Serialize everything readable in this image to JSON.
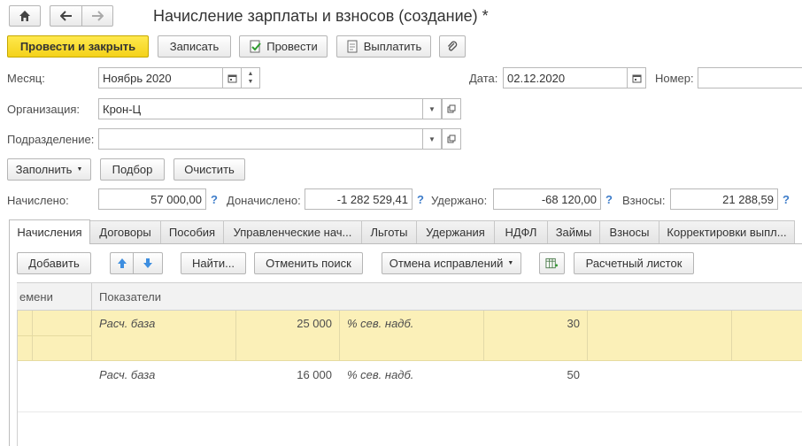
{
  "window": {
    "title": "Начисление зарплаты и взносов (создание) *"
  },
  "toolbar": {
    "post_close": "Провести и закрыть",
    "save": "Записать",
    "post": "Провести",
    "pay": "Выплатить"
  },
  "form": {
    "month_label": "Месяц:",
    "month_value": "Ноябрь 2020",
    "date_label": "Дата:",
    "date_value": "02.12.2020",
    "number_label": "Номер:",
    "number_value": "",
    "org_label": "Организация:",
    "org_value": "Крон-Ц",
    "dept_label": "Подразделение:",
    "dept_value": ""
  },
  "actions": {
    "fill": "Заполнить",
    "select": "Подбор",
    "clear": "Очистить"
  },
  "totals": {
    "accrued_label": "Начислено:",
    "accrued_value": "57 000,00",
    "extra_label": "Доначислено:",
    "extra_value": "-1 282 529,41",
    "withheld_label": "Удержано:",
    "withheld_value": "-68 120,00",
    "contrib_label": "Взносы:",
    "contrib_value": "21 288,59",
    "help": "?"
  },
  "tabs": [
    {
      "label": "Начисления"
    },
    {
      "label": "Договоры"
    },
    {
      "label": "Пособия"
    },
    {
      "label": "Управленческие нач..."
    },
    {
      "label": "Льготы"
    },
    {
      "label": "Удержания"
    },
    {
      "label": "НДФЛ"
    },
    {
      "label": "Займы"
    },
    {
      "label": "Взносы"
    },
    {
      "label": "Корректировки выпл..."
    }
  ],
  "table_toolbar": {
    "add": "Добавить",
    "find": "Найти...",
    "cancel_search": "Отменить поиск",
    "cancel_corrections": "Отмена исправлений",
    "payslip": "Расчетный листок"
  },
  "table": {
    "col_time": "емени",
    "col_indicators": "Показатели",
    "rows": [
      {
        "ind1": "Расч. база",
        "val1": "25 000",
        "ind2": "% сев. надб.",
        "val2": "30"
      },
      {
        "ind1": "Расч. база",
        "val1": "16 000",
        "ind2": "% сев. надб.",
        "val2": "50"
      }
    ]
  },
  "colors": {
    "accent_yellow": "#f4d21a",
    "row_selected": "#fbf0b8",
    "help_blue": "#3d7cc9"
  }
}
